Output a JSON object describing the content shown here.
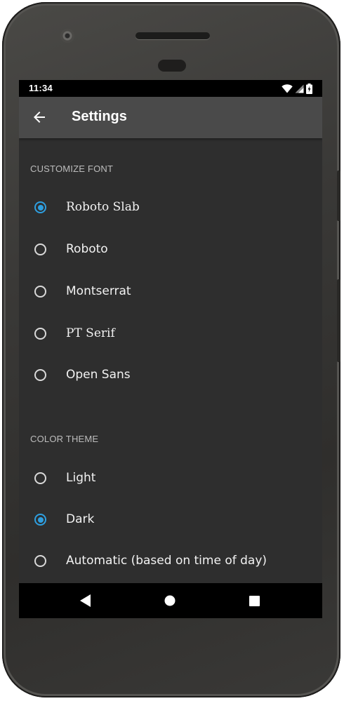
{
  "status_bar": {
    "time": "11:34",
    "icons": [
      "wifi-icon",
      "signal-icon",
      "battery-charging-icon"
    ]
  },
  "app_bar": {
    "back_icon": "arrow-back-icon",
    "title": "Settings"
  },
  "sections": {
    "font": {
      "header": "CUSTOMIZE FONT",
      "options": [
        {
          "label": "Roboto Slab",
          "selected": true
        },
        {
          "label": "Roboto",
          "selected": false
        },
        {
          "label": "Montserrat",
          "selected": false
        },
        {
          "label": "PT Serif",
          "selected": false
        },
        {
          "label": "Open Sans",
          "selected": false
        }
      ]
    },
    "theme": {
      "header": "COLOR THEME",
      "options": [
        {
          "label": "Light",
          "selected": false
        },
        {
          "label": "Dark",
          "selected": true
        },
        {
          "label": "Automatic (based on time of day)",
          "selected": false
        }
      ]
    }
  },
  "nav_bar": {
    "icons": [
      "back-triangle-icon",
      "home-circle-icon",
      "recents-square-icon"
    ]
  },
  "colors": {
    "accent": "#2e9fe0",
    "background": "#2e2e2e",
    "app_bar": "#4a4a4a"
  }
}
